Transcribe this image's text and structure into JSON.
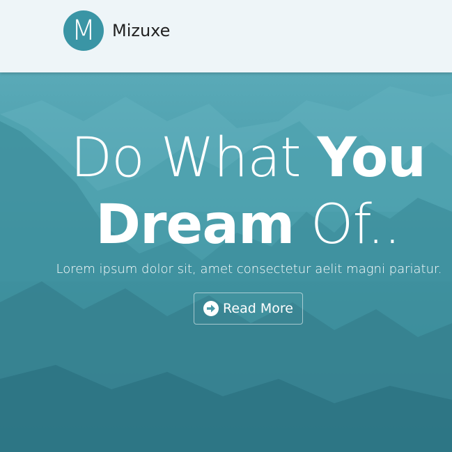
{
  "brand": {
    "logo_letter": "M",
    "name": "Mizuxe"
  },
  "hero": {
    "headline_light_1": "Do What ",
    "headline_bold": "You",
    "headline_bold_2": "Dream",
    "headline_light_2": " Of..",
    "subtitle": "Lorem ipsum dolor sit, amet consectetur aelit magni pariatur.",
    "button_label": "Read More",
    "button_icon": "arrow-right-circle-icon"
  },
  "colors": {
    "nav_bg": "#eef5f8",
    "logo_bg": "#3a95a5",
    "hero_tint": "#3d8e9c",
    "text_light": "#ffffff"
  }
}
